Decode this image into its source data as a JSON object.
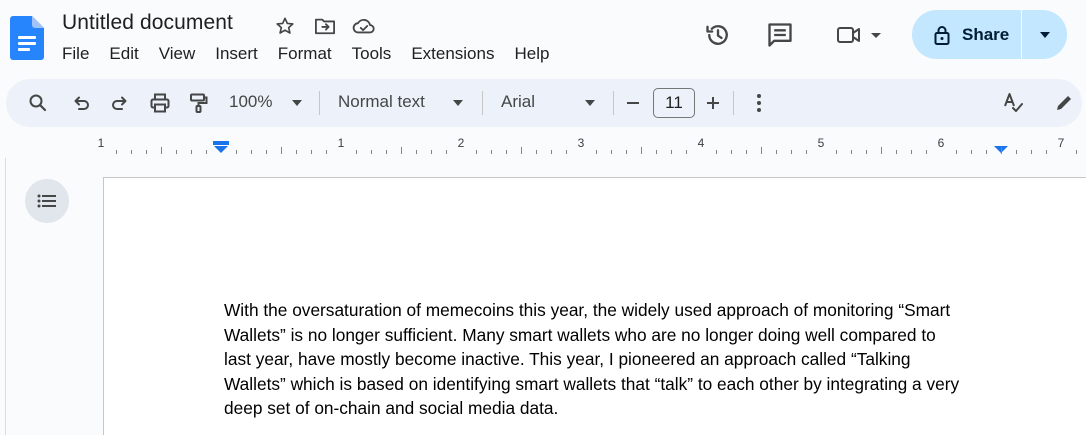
{
  "app": {
    "title": "Untitled document",
    "menu": [
      "File",
      "Edit",
      "View",
      "Insert",
      "Format",
      "Tools",
      "Extensions",
      "Help"
    ],
    "icons": {
      "logo": "google-docs-logo",
      "star": "star-icon",
      "move": "move-folder-icon",
      "cloud": "cloud-status-icon",
      "history": "version-history-icon",
      "comments": "comments-icon",
      "meet": "video-call-icon"
    }
  },
  "share": {
    "label": "Share"
  },
  "toolbar": {
    "zoom": "100%",
    "style": "Normal text",
    "font": "Arial",
    "font_size": "11",
    "minus": "−",
    "plus": "+"
  },
  "ruler": {
    "numbers": [
      "1",
      "1",
      "2",
      "3",
      "4",
      "5",
      "6",
      "7"
    ]
  },
  "document": {
    "lines": [
      "With the oversaturation of memecoins this year, the widely used approach of monitoring “Smart",
      "Wallets” is no longer sufficient. Many smart wallets who are no longer doing well compared to",
      "last year, have mostly become inactive. This year, I pioneered an approach called “Talking",
      "Wallets” which is based on identifying smart wallets that “talk” to each other by integrating a very",
      "deep set of on-chain and social media data."
    ]
  },
  "colors": {
    "accent": "#1a73e8",
    "share_bg": "#c2e7ff",
    "toolbar_bg": "#edf2fa",
    "page_bg": "#ffffff",
    "background": "#f9fbfd"
  }
}
